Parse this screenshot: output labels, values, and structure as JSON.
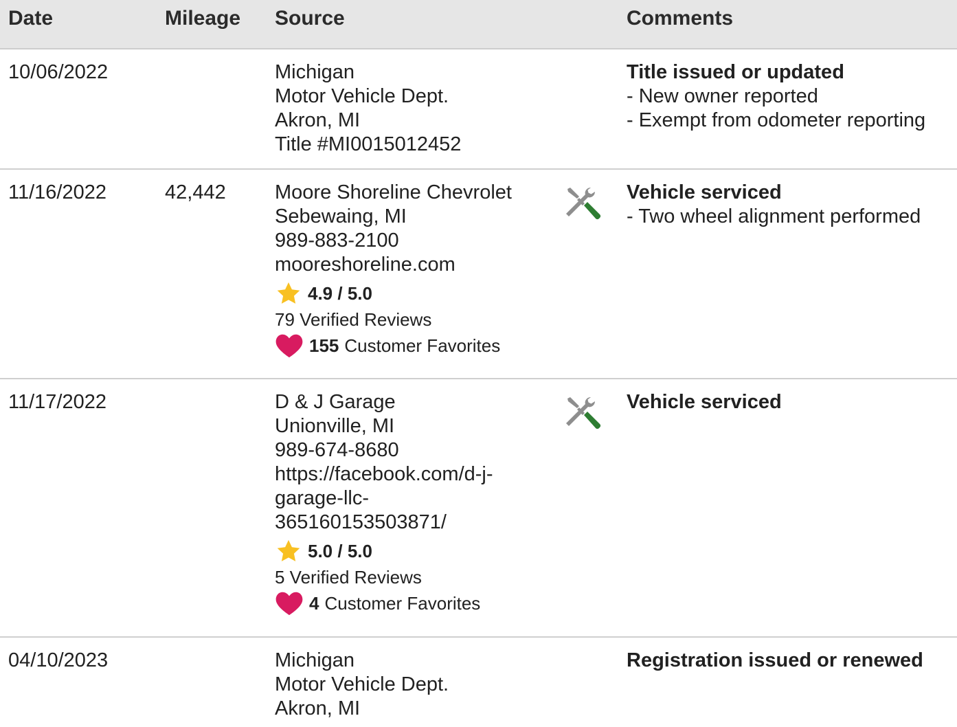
{
  "headers": {
    "date": "Date",
    "mileage": "Mileage",
    "source": "Source",
    "comments": "Comments"
  },
  "colors": {
    "star": "#F8C022",
    "heart": "#D81B60",
    "wrench_gray": "#8E8E8E",
    "screwdriver_green": "#2E7D32"
  },
  "rows": [
    {
      "date": "10/06/2022",
      "mileage": "",
      "source": [
        "Michigan",
        "Motor Vehicle Dept.",
        "Akron, MI",
        "Title #MI0015012452"
      ],
      "comment_title": "Title issued or updated",
      "comment_lines": [
        "- New owner reported",
        "- Exempt from odometer reporting"
      ]
    },
    {
      "date": "11/16/2022",
      "mileage": "42,442",
      "source": [
        "Moore Shoreline Chevrolet",
        "Sebewaing, MI",
        "989-883-2100",
        "mooreshoreline.com"
      ],
      "rating": "4.9 / 5.0",
      "reviews": "79 Verified Reviews",
      "favorites_count": "155",
      "favorites_label": "Customer Favorites",
      "icon": "service-tools-icon",
      "comment_title": "Vehicle serviced",
      "comment_lines": [
        "- Two wheel alignment performed"
      ]
    },
    {
      "date": "11/17/2022",
      "mileage": "",
      "source": [
        "D & J Garage",
        "Unionville, MI",
        "989-674-8680",
        "https://facebook.com/d-j-",
        "garage-llc-",
        "365160153503871/"
      ],
      "rating": "5.0 / 5.0",
      "reviews": "5 Verified Reviews",
      "favorites_count": "4",
      "favorites_label": "Customer Favorites",
      "icon": "service-tools-icon",
      "comment_title": "Vehicle serviced",
      "comment_lines": []
    },
    {
      "date": "04/10/2023",
      "mileage": "",
      "source": [
        "Michigan",
        "Motor Vehicle Dept.",
        "Akron, MI"
      ],
      "comment_title": "Registration issued or renewed",
      "comment_lines": []
    }
  ]
}
